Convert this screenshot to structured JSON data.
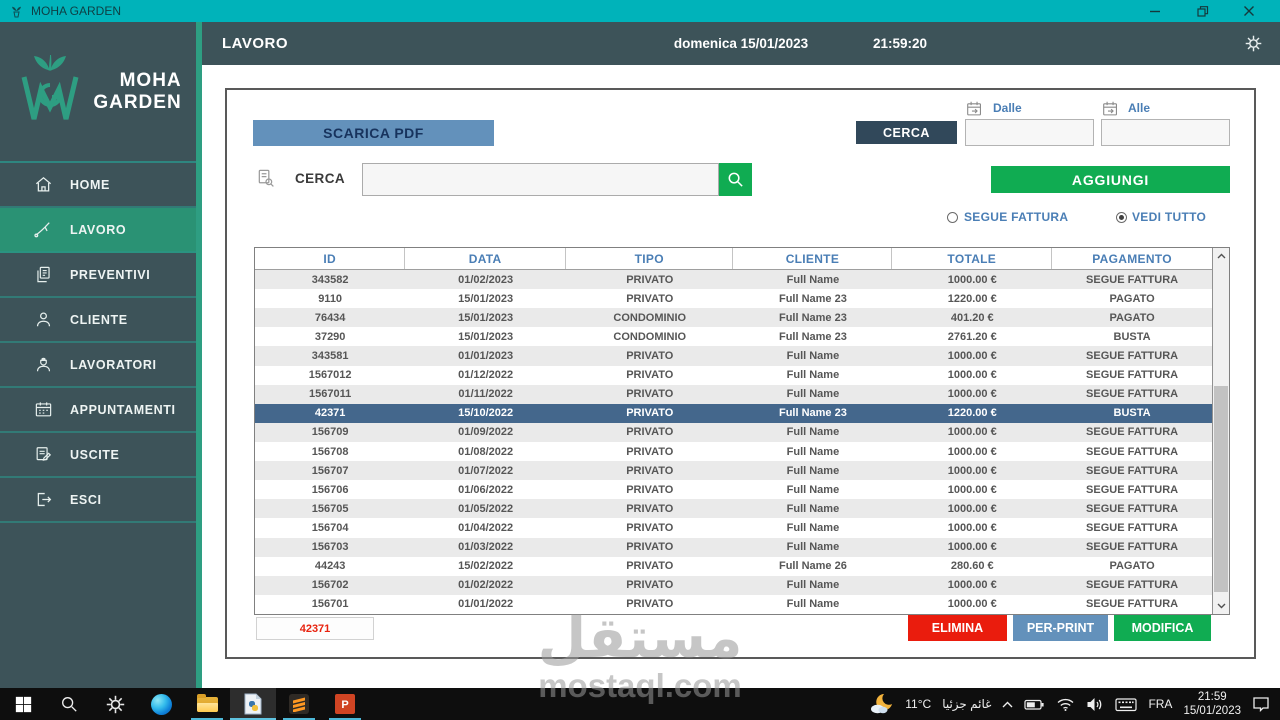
{
  "window": {
    "title": "MOHA GARDEN"
  },
  "sidebar": {
    "brand_line1": "MOHA",
    "brand_line2": "GARDEN",
    "items": [
      {
        "label": "HOME",
        "icon": "home-icon",
        "active": false
      },
      {
        "label": "LAVORO",
        "icon": "garden-tool-icon",
        "active": true
      },
      {
        "label": "PREVENTIVI",
        "icon": "documents-icon",
        "active": false
      },
      {
        "label": "CLIENTE",
        "icon": "client-icon",
        "active": false
      },
      {
        "label": "LAVORATORI",
        "icon": "workers-icon",
        "active": false
      },
      {
        "label": "APPUNTAMENTI",
        "icon": "calendar-icon",
        "active": false
      },
      {
        "label": "USCITE",
        "icon": "expenses-icon",
        "active": false
      },
      {
        "label": "ESCI",
        "icon": "exit-icon",
        "active": false
      }
    ]
  },
  "header": {
    "title": "LAVORO",
    "date": "domenica 15/01/2023",
    "time": "21:59:20"
  },
  "toolbar": {
    "scarica_pdf_label": "SCARICA PDF",
    "cerca_label": "CERCA",
    "search_value": "",
    "cerca_button_label": "CERCA",
    "dalle_label": "Dalle",
    "alle_label": "Alle",
    "dalle_value": "",
    "alle_value": "",
    "aggiungi_label": "AGGIUNGI",
    "radio_segue_label": "SEGUE FATTURA",
    "radio_vedi_label": "VEDI TUTTO",
    "radio_selected": "VEDI TUTTO"
  },
  "table": {
    "columns": [
      "ID",
      "DATA",
      "TIPO",
      "CLIENTE",
      "TOTALE",
      "PAGAMENTO"
    ],
    "rows": [
      {
        "id": "343582",
        "data": "01/02/2023",
        "tipo": "PRIVATO",
        "cliente": "Full Name",
        "totale": "1000.00 €",
        "pagamento": "SEGUE FATTURA",
        "selected": false
      },
      {
        "id": "9110",
        "data": "15/01/2023",
        "tipo": "PRIVATO",
        "cliente": "Full Name 23",
        "totale": "1220.00 €",
        "pagamento": "PAGATO",
        "selected": false
      },
      {
        "id": "76434",
        "data": "15/01/2023",
        "tipo": "CONDOMINIO",
        "cliente": "Full Name 23",
        "totale": "401.20 €",
        "pagamento": "PAGATO",
        "selected": false
      },
      {
        "id": "37290",
        "data": "15/01/2023",
        "tipo": "CONDOMINIO",
        "cliente": "Full Name 23",
        "totale": "2761.20 €",
        "pagamento": "BUSTA",
        "selected": false
      },
      {
        "id": "343581",
        "data": "01/01/2023",
        "tipo": "PRIVATO",
        "cliente": "Full Name",
        "totale": "1000.00 €",
        "pagamento": "SEGUE FATTURA",
        "selected": false
      },
      {
        "id": "1567012",
        "data": "01/12/2022",
        "tipo": "PRIVATO",
        "cliente": "Full Name",
        "totale": "1000.00 €",
        "pagamento": "SEGUE FATTURA",
        "selected": false
      },
      {
        "id": "1567011",
        "data": "01/11/2022",
        "tipo": "PRIVATO",
        "cliente": "Full Name",
        "totale": "1000.00 €",
        "pagamento": "SEGUE FATTURA",
        "selected": false
      },
      {
        "id": "42371",
        "data": "15/10/2022",
        "tipo": "PRIVATO",
        "cliente": "Full Name 23",
        "totale": "1220.00 €",
        "pagamento": "BUSTA",
        "selected": true
      },
      {
        "id": "156709",
        "data": "01/09/2022",
        "tipo": "PRIVATO",
        "cliente": "Full Name",
        "totale": "1000.00 €",
        "pagamento": "SEGUE FATTURA",
        "selected": false
      },
      {
        "id": "156708",
        "data": "01/08/2022",
        "tipo": "PRIVATO",
        "cliente": "Full Name",
        "totale": "1000.00 €",
        "pagamento": "SEGUE FATTURA",
        "selected": false
      },
      {
        "id": "156707",
        "data": "01/07/2022",
        "tipo": "PRIVATO",
        "cliente": "Full Name",
        "totale": "1000.00 €",
        "pagamento": "SEGUE FATTURA",
        "selected": false
      },
      {
        "id": "156706",
        "data": "01/06/2022",
        "tipo": "PRIVATO",
        "cliente": "Full Name",
        "totale": "1000.00 €",
        "pagamento": "SEGUE FATTURA",
        "selected": false
      },
      {
        "id": "156705",
        "data": "01/05/2022",
        "tipo": "PRIVATO",
        "cliente": "Full Name",
        "totale": "1000.00 €",
        "pagamento": "SEGUE FATTURA",
        "selected": false
      },
      {
        "id": "156704",
        "data": "01/04/2022",
        "tipo": "PRIVATO",
        "cliente": "Full Name",
        "totale": "1000.00 €",
        "pagamento": "SEGUE FATTURA",
        "selected": false
      },
      {
        "id": "156703",
        "data": "01/03/2022",
        "tipo": "PRIVATO",
        "cliente": "Full Name",
        "totale": "1000.00 €",
        "pagamento": "SEGUE FATTURA",
        "selected": false
      },
      {
        "id": "44243",
        "data": "15/02/2022",
        "tipo": "PRIVATO",
        "cliente": "Full Name 26",
        "totale": "280.60 €",
        "pagamento": "PAGATO",
        "selected": false
      },
      {
        "id": "156702",
        "data": "01/02/2022",
        "tipo": "PRIVATO",
        "cliente": "Full Name",
        "totale": "1000.00 €",
        "pagamento": "SEGUE FATTURA",
        "selected": false
      },
      {
        "id": "156701",
        "data": "01/01/2022",
        "tipo": "PRIVATO",
        "cliente": "Full Name",
        "totale": "1000.00 €",
        "pagamento": "SEGUE FATTURA",
        "selected": false
      }
    ]
  },
  "footer": {
    "selected_id": "42371",
    "elimina_label": "ELIMINA",
    "per_print_label": "PER-PRINT",
    "modifica_label": "MODIFICA"
  },
  "watermark": {
    "line1": "مستقل",
    "line2": "mostaql.com"
  },
  "taskbar": {
    "temperature": "11°C",
    "condition": "غائم جزئيا",
    "language": "FRA",
    "time": "21:59",
    "date": "15/01/2023"
  },
  "colors": {
    "titlebar": "#00b3ba",
    "sidebar": "#3d5359",
    "active_green": "#2a9274",
    "button_green": "#10ac52",
    "button_blue": "#6391bb",
    "button_dark": "#31485a",
    "button_red": "#ea1c0d",
    "selected_row": "#44678c",
    "link_blue": "#4a7eb5",
    "id_text_red": "#e8220e"
  }
}
